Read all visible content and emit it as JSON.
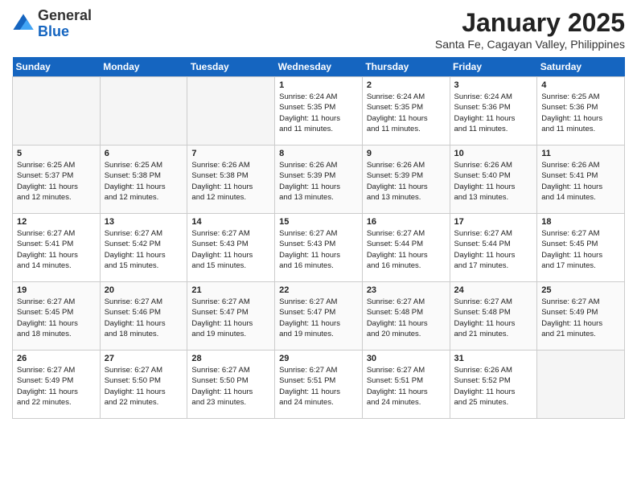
{
  "header": {
    "logo_general": "General",
    "logo_blue": "Blue",
    "month_title": "January 2025",
    "location": "Santa Fe, Cagayan Valley, Philippines"
  },
  "weekdays": [
    "Sunday",
    "Monday",
    "Tuesday",
    "Wednesday",
    "Thursday",
    "Friday",
    "Saturday"
  ],
  "weeks": [
    [
      {
        "day": "",
        "info": ""
      },
      {
        "day": "",
        "info": ""
      },
      {
        "day": "",
        "info": ""
      },
      {
        "day": "1",
        "info": "Sunrise: 6:24 AM\nSunset: 5:35 PM\nDaylight: 11 hours\nand 11 minutes."
      },
      {
        "day": "2",
        "info": "Sunrise: 6:24 AM\nSunset: 5:35 PM\nDaylight: 11 hours\nand 11 minutes."
      },
      {
        "day": "3",
        "info": "Sunrise: 6:24 AM\nSunset: 5:36 PM\nDaylight: 11 hours\nand 11 minutes."
      },
      {
        "day": "4",
        "info": "Sunrise: 6:25 AM\nSunset: 5:36 PM\nDaylight: 11 hours\nand 11 minutes."
      }
    ],
    [
      {
        "day": "5",
        "info": "Sunrise: 6:25 AM\nSunset: 5:37 PM\nDaylight: 11 hours\nand 12 minutes."
      },
      {
        "day": "6",
        "info": "Sunrise: 6:25 AM\nSunset: 5:38 PM\nDaylight: 11 hours\nand 12 minutes."
      },
      {
        "day": "7",
        "info": "Sunrise: 6:26 AM\nSunset: 5:38 PM\nDaylight: 11 hours\nand 12 minutes."
      },
      {
        "day": "8",
        "info": "Sunrise: 6:26 AM\nSunset: 5:39 PM\nDaylight: 11 hours\nand 13 minutes."
      },
      {
        "day": "9",
        "info": "Sunrise: 6:26 AM\nSunset: 5:39 PM\nDaylight: 11 hours\nand 13 minutes."
      },
      {
        "day": "10",
        "info": "Sunrise: 6:26 AM\nSunset: 5:40 PM\nDaylight: 11 hours\nand 13 minutes."
      },
      {
        "day": "11",
        "info": "Sunrise: 6:26 AM\nSunset: 5:41 PM\nDaylight: 11 hours\nand 14 minutes."
      }
    ],
    [
      {
        "day": "12",
        "info": "Sunrise: 6:27 AM\nSunset: 5:41 PM\nDaylight: 11 hours\nand 14 minutes."
      },
      {
        "day": "13",
        "info": "Sunrise: 6:27 AM\nSunset: 5:42 PM\nDaylight: 11 hours\nand 15 minutes."
      },
      {
        "day": "14",
        "info": "Sunrise: 6:27 AM\nSunset: 5:43 PM\nDaylight: 11 hours\nand 15 minutes."
      },
      {
        "day": "15",
        "info": "Sunrise: 6:27 AM\nSunset: 5:43 PM\nDaylight: 11 hours\nand 16 minutes."
      },
      {
        "day": "16",
        "info": "Sunrise: 6:27 AM\nSunset: 5:44 PM\nDaylight: 11 hours\nand 16 minutes."
      },
      {
        "day": "17",
        "info": "Sunrise: 6:27 AM\nSunset: 5:44 PM\nDaylight: 11 hours\nand 17 minutes."
      },
      {
        "day": "18",
        "info": "Sunrise: 6:27 AM\nSunset: 5:45 PM\nDaylight: 11 hours\nand 17 minutes."
      }
    ],
    [
      {
        "day": "19",
        "info": "Sunrise: 6:27 AM\nSunset: 5:45 PM\nDaylight: 11 hours\nand 18 minutes."
      },
      {
        "day": "20",
        "info": "Sunrise: 6:27 AM\nSunset: 5:46 PM\nDaylight: 11 hours\nand 18 minutes."
      },
      {
        "day": "21",
        "info": "Sunrise: 6:27 AM\nSunset: 5:47 PM\nDaylight: 11 hours\nand 19 minutes."
      },
      {
        "day": "22",
        "info": "Sunrise: 6:27 AM\nSunset: 5:47 PM\nDaylight: 11 hours\nand 19 minutes."
      },
      {
        "day": "23",
        "info": "Sunrise: 6:27 AM\nSunset: 5:48 PM\nDaylight: 11 hours\nand 20 minutes."
      },
      {
        "day": "24",
        "info": "Sunrise: 6:27 AM\nSunset: 5:48 PM\nDaylight: 11 hours\nand 21 minutes."
      },
      {
        "day": "25",
        "info": "Sunrise: 6:27 AM\nSunset: 5:49 PM\nDaylight: 11 hours\nand 21 minutes."
      }
    ],
    [
      {
        "day": "26",
        "info": "Sunrise: 6:27 AM\nSunset: 5:49 PM\nDaylight: 11 hours\nand 22 minutes."
      },
      {
        "day": "27",
        "info": "Sunrise: 6:27 AM\nSunset: 5:50 PM\nDaylight: 11 hours\nand 22 minutes."
      },
      {
        "day": "28",
        "info": "Sunrise: 6:27 AM\nSunset: 5:50 PM\nDaylight: 11 hours\nand 23 minutes."
      },
      {
        "day": "29",
        "info": "Sunrise: 6:27 AM\nSunset: 5:51 PM\nDaylight: 11 hours\nand 24 minutes."
      },
      {
        "day": "30",
        "info": "Sunrise: 6:27 AM\nSunset: 5:51 PM\nDaylight: 11 hours\nand 24 minutes."
      },
      {
        "day": "31",
        "info": "Sunrise: 6:26 AM\nSunset: 5:52 PM\nDaylight: 11 hours\nand 25 minutes."
      },
      {
        "day": "",
        "info": ""
      }
    ]
  ]
}
